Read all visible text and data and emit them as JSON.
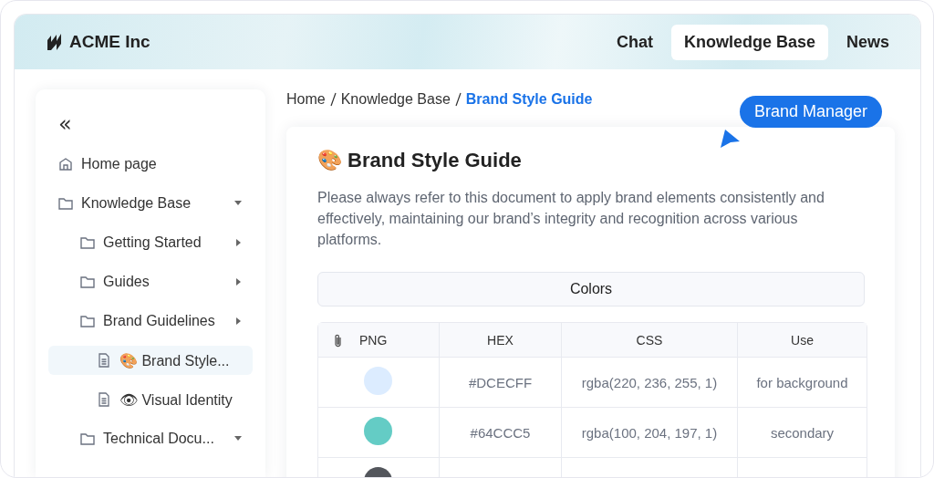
{
  "header": {
    "brand": "ACME Inc",
    "tabs": [
      {
        "label": "Chat",
        "selected": false
      },
      {
        "label": "Knowledge Base",
        "selected": true
      },
      {
        "label": "News",
        "selected": false
      }
    ]
  },
  "sidebar": {
    "collapse": "«",
    "items": [
      {
        "kind": "home",
        "label": "Home page",
        "selected": false
      },
      {
        "kind": "folder",
        "label": "Knowledge Base",
        "expanded": true,
        "selected": false,
        "children": [
          {
            "kind": "folder",
            "label": "Getting Started",
            "expanded": false,
            "selected": false
          },
          {
            "kind": "folder",
            "label": "Guides",
            "expanded": false,
            "selected": false
          },
          {
            "kind": "folder",
            "label": "Brand Guidelines",
            "expanded": false,
            "selected": false
          },
          {
            "kind": "page",
            "label": "🎨 Brand Style...",
            "selected": true
          },
          {
            "kind": "page",
            "label": "👁 Visual Identity",
            "selected": false
          },
          {
            "kind": "folder",
            "label": "Technical Docu...",
            "expanded": true,
            "selected": false
          }
        ]
      }
    ]
  },
  "breadcrumb": [
    {
      "label": "Home",
      "current": false
    },
    {
      "label": "Knowledge Base",
      "current": false
    },
    {
      "label": "Brand Style Guide",
      "current": true
    }
  ],
  "tooltip": {
    "label": "Brand Manager"
  },
  "document": {
    "title": "🎨 Brand Style Guide",
    "intro": "Please always refer to this document to apply brand elements consistently and effectively, maintaining our brand’s integrity and recognition across various platforms.",
    "section": "Colors",
    "table": {
      "columns": [
        "PNG",
        "HEX",
        "CSS",
        "Use"
      ],
      "rows": [
        {
          "color": "#dcecff",
          "hex": "#DCECFF",
          "css": "rgba(220, 236, 255, 1)",
          "use": "for background"
        },
        {
          "color": "#64ccc5",
          "hex": "#64CCC5",
          "css": "rgba(100, 204, 197, 1)",
          "use": "secondary"
        },
        {
          "color": "#53565c"
        }
      ]
    }
  }
}
